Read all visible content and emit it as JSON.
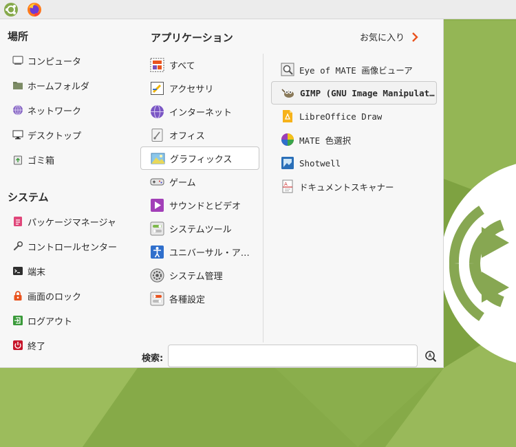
{
  "colors": {
    "desktop_green": "#8db04e",
    "accent_orange": "#e9531e",
    "menu_bg": "#f7f7f7"
  },
  "top_panel": {
    "icons": [
      "mate-menu-icon",
      "firefox-icon"
    ]
  },
  "places": {
    "title": "場所",
    "items": [
      {
        "label": "コンピュータ",
        "icon": "computer-icon"
      },
      {
        "label": "ホームフォルダ",
        "icon": "folder-icon"
      },
      {
        "label": "ネットワーク",
        "icon": "network-icon"
      },
      {
        "label": "デスクトップ",
        "icon": "desktop-icon"
      },
      {
        "label": "ゴミ箱",
        "icon": "trash-icon"
      }
    ]
  },
  "system": {
    "title": "システム",
    "items": [
      {
        "label": "パッケージマネージャ",
        "icon": "package-icon"
      },
      {
        "label": "コントロールセンター",
        "icon": "wrench-icon"
      },
      {
        "label": "端末",
        "icon": "terminal-icon"
      },
      {
        "label": "画面のロック",
        "icon": "lock-icon"
      },
      {
        "label": "ログアウト",
        "icon": "logout-icon"
      },
      {
        "label": "終了",
        "icon": "power-icon"
      }
    ]
  },
  "applications": {
    "title": "アプリケーション",
    "favorites_label": "お気に入り",
    "categories": [
      {
        "label": "すべて",
        "icon": "all-apps-icon"
      },
      {
        "label": "アクセサリ",
        "icon": "accessories-icon"
      },
      {
        "label": "インターネット",
        "icon": "internet-icon"
      },
      {
        "label": "オフィス",
        "icon": "office-icon"
      },
      {
        "label": "グラフィックス",
        "icon": "graphics-icon",
        "selected": true
      },
      {
        "label": "ゲーム",
        "icon": "games-icon"
      },
      {
        "label": "サウンドとビデオ",
        "icon": "multimedia-icon"
      },
      {
        "label": "システムツール",
        "icon": "system-tools-icon"
      },
      {
        "label": "ユニバーサル・ア…",
        "icon": "accessibility-icon"
      },
      {
        "label": "システム管理",
        "icon": "administration-icon"
      },
      {
        "label": "各種設定",
        "icon": "preferences-icon"
      }
    ],
    "apps": [
      {
        "label": "Eye of MATE 画像ビューア",
        "icon": "image-viewer-icon"
      },
      {
        "label": "GIMP (GNU Image Manipulat…",
        "icon": "gimp-icon",
        "selected": true
      },
      {
        "label": "LibreOffice Draw",
        "icon": "libreoffice-draw-icon"
      },
      {
        "label": "MATE 色選択",
        "icon": "color-picker-icon"
      },
      {
        "label": "Shotwell",
        "icon": "shotwell-icon"
      },
      {
        "label": "ドキュメントスキャナー",
        "icon": "scanner-icon"
      }
    ]
  },
  "search": {
    "label": "検索:",
    "value": "",
    "placeholder": ""
  }
}
